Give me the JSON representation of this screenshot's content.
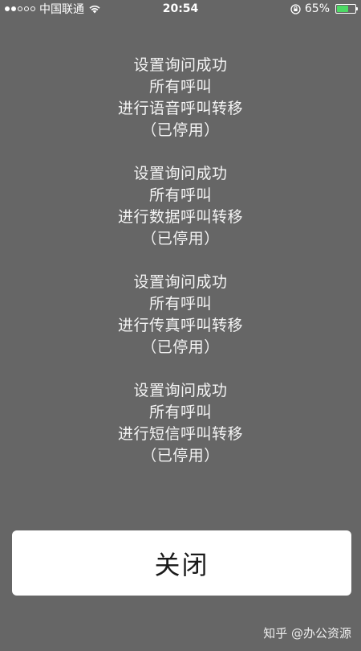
{
  "status_bar": {
    "carrier": "中国联通",
    "time": "20:54",
    "battery": "65%",
    "battery_level": 0.65,
    "signal_filled": 2,
    "signal_total": 5
  },
  "messages": [
    {
      "title": "设置询问成功",
      "line2": "所有呼叫",
      "line3": "进行语音呼叫转移",
      "status": "（已停用）"
    },
    {
      "title": "设置询问成功",
      "line2": "所有呼叫",
      "line3": "进行数据呼叫转移",
      "status": "（已停用）"
    },
    {
      "title": "设置询问成功",
      "line2": "所有呼叫",
      "line3": "进行传真呼叫转移",
      "status": "（已停用）"
    },
    {
      "title": "设置询问成功",
      "line2": "所有呼叫",
      "line3": "进行短信呼叫转移",
      "status": "（已停用）"
    }
  ],
  "close_button": {
    "label": "关闭"
  },
  "watermark": "知乎 @办公资源"
}
